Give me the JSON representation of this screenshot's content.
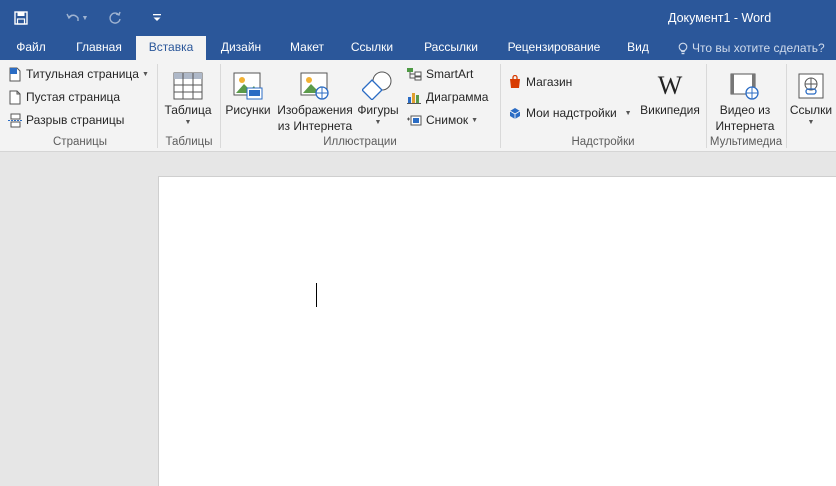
{
  "titlebar": {
    "title": "Документ1 - Word",
    "background_color": "#2b579a",
    "quick_access": {
      "save_icon": "save-icon",
      "undo_icon": "undo-icon",
      "redo_icon": "redo-icon",
      "customize_icon": "customize-qat-icon"
    }
  },
  "tabs": [
    {
      "label": "Файл"
    },
    {
      "label": "Главная"
    },
    {
      "label": "Вставка",
      "active": true
    },
    {
      "label": "Дизайн"
    },
    {
      "label": "Макет"
    },
    {
      "label": "Ссылки"
    },
    {
      "label": "Рассылки"
    },
    {
      "label": "Рецензирование"
    },
    {
      "label": "Вид"
    }
  ],
  "tell_me": {
    "placeholder": "Что вы хотите сделать?",
    "icon": "lightbulb-icon"
  },
  "ribbon": {
    "pages": {
      "label": "Страницы",
      "cover_page": "Титульная страница",
      "blank_page": "Пустая страница",
      "page_break": "Разрыв страницы"
    },
    "tables": {
      "label": "Таблицы",
      "table": "Таблица"
    },
    "illustrations": {
      "label": "Иллюстрации",
      "pictures": "Рисунки",
      "online_pictures_1": "Изображения",
      "online_pictures_2": "из Интернета",
      "shapes": "Фигуры",
      "smartart": "SmartArt",
      "chart": "Диаграмма",
      "screenshot": "Снимок"
    },
    "addins": {
      "label": "Надстройки",
      "store": "Магазин",
      "my_addins": "Мои надстройки",
      "wikipedia": "Википедия"
    },
    "media": {
      "label": "Мультимедиа",
      "online_video_1": "Видео из",
      "online_video_2": "Интернета"
    },
    "links": {
      "label": "Ссылки"
    }
  },
  "document": {
    "content": ""
  }
}
